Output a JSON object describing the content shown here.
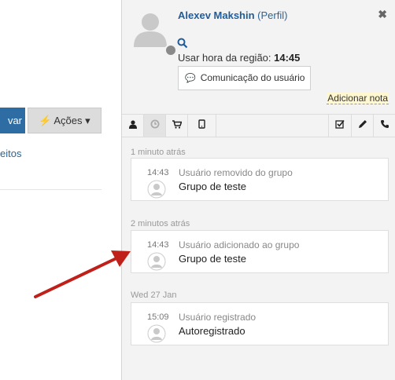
{
  "left": {
    "save_button": "var",
    "actions_button": "Ações",
    "link_text": "eitos"
  },
  "panel": {
    "user_name": "Alexev Makshin",
    "profile_link": "(Perfil)",
    "timezone_label": "Usar hora da região:",
    "timezone_value": "14:45",
    "comm_button": "Comunicação do usuário",
    "add_note": "Adicionar nota"
  },
  "tabs": {
    "left": [
      "user-icon",
      "history-icon",
      "cart-icon",
      "tablet-icon"
    ],
    "right": [
      "checkbox-icon",
      "pencil-icon",
      "phone-icon"
    ]
  },
  "groups": [
    {
      "label": "1 minuto atrás",
      "entries": [
        {
          "time": "14:43",
          "action": "Usuário removido do grupo",
          "target": "Grupo de teste"
        }
      ]
    },
    {
      "label": "2 minutos atrás",
      "entries": [
        {
          "time": "14:43",
          "action": "Usuário adicionado ao grupo",
          "target": "Grupo de teste"
        }
      ]
    },
    {
      "label": "Wed 27 Jan",
      "entries": [
        {
          "time": "15:09",
          "action": "Usuário registrado",
          "target": "Autoregistrado"
        }
      ]
    }
  ],
  "colors": {
    "accent": "#2e6da4",
    "arrow": "#c0201a"
  }
}
